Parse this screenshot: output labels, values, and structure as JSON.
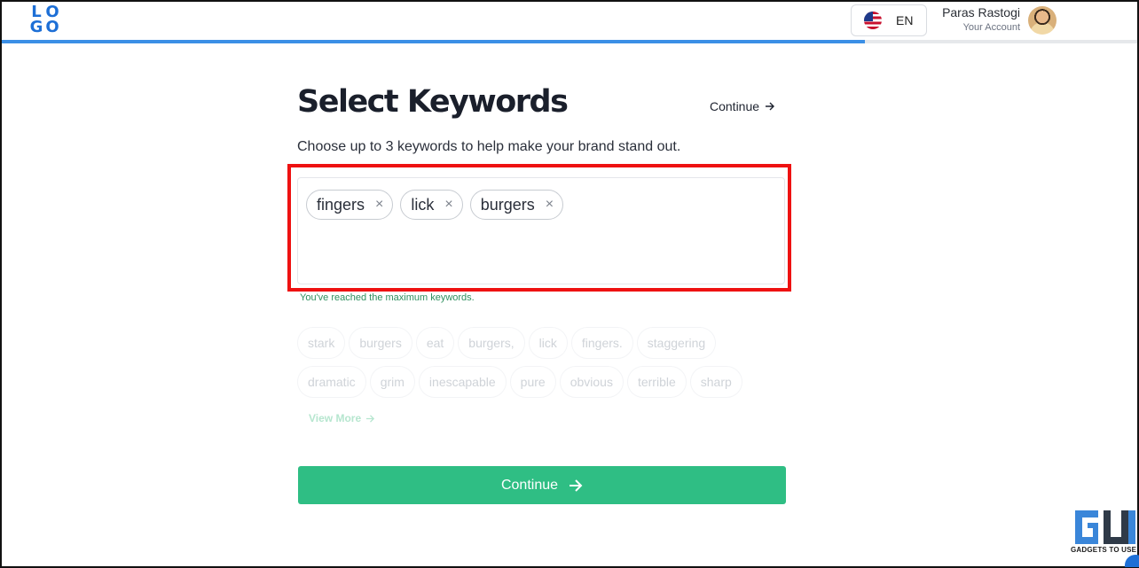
{
  "header": {
    "logo_letters": [
      "L",
      "O",
      "G",
      "O"
    ],
    "progress_fraction": 0.76,
    "language": {
      "code": "EN",
      "flag_icon": "us-flag-icon"
    },
    "account": {
      "name": "Paras Rastogi",
      "sub_label": "Your Account"
    }
  },
  "main": {
    "title": "Select Keywords",
    "top_continue_label": "Continue",
    "subtitle": "Choose up to 3 keywords to help make your brand stand out.",
    "selected_keywords": [
      "fingers",
      "lick",
      "burgers"
    ],
    "remove_glyph": "×",
    "max_message": "You've reached the maximum keywords.",
    "suggestions_row1": [
      "stark",
      "burgers",
      "eat",
      "burgers,",
      "lick",
      "fingers.",
      "staggering"
    ],
    "suggestions_row2": [
      "dramatic",
      "grim",
      "inescapable",
      "pure",
      "obvious",
      "terrible",
      "sharp"
    ],
    "view_more_label": "View More",
    "continue_button_label": "Continue"
  },
  "watermark": {
    "text": "GADGETS TO USE"
  },
  "colors": {
    "accent_green": "#2fbe84",
    "logo_blue": "#1d6fd6",
    "progress_blue": "#3b8fe6",
    "highlight_red": "#ee1111"
  }
}
